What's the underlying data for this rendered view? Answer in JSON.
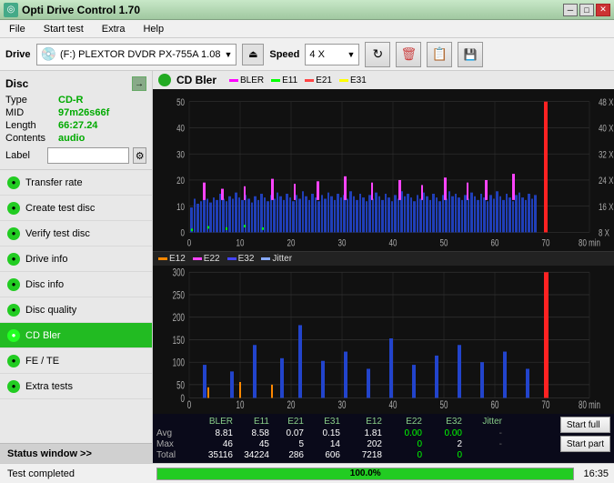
{
  "titleBar": {
    "icon": "◎",
    "title": "Opti Drive Control 1.70",
    "minimize": "─",
    "maximize": "□",
    "close": "✕"
  },
  "menuBar": {
    "items": [
      "File",
      "Start test",
      "Extra",
      "Help"
    ]
  },
  "toolbar": {
    "driveLabel": "Drive",
    "driveText": "(F:) PLEXTOR DVDR  PX-755A 1.08",
    "speedLabel": "Speed",
    "speedValue": "4 X"
  },
  "disc": {
    "title": "Disc",
    "type": {
      "key": "Type",
      "val": "CD-R"
    },
    "mid": {
      "key": "MID",
      "val": "97m26s66f"
    },
    "length": {
      "key": "Length",
      "val": "66:27.24"
    },
    "contents": {
      "key": "Contents",
      "val": "audio"
    },
    "label": {
      "key": "Label",
      "val": ""
    }
  },
  "sidebarNav": [
    {
      "id": "transfer-rate",
      "label": "Transfer rate",
      "active": false
    },
    {
      "id": "create-test-disc",
      "label": "Create test disc",
      "active": false
    },
    {
      "id": "verify-test-disc",
      "label": "Verify test disc",
      "active": false
    },
    {
      "id": "drive-info",
      "label": "Drive info",
      "active": false
    },
    {
      "id": "disc-info",
      "label": "Disc info",
      "active": false
    },
    {
      "id": "disc-quality",
      "label": "Disc quality",
      "active": false
    },
    {
      "id": "cd-bler",
      "label": "CD Bler",
      "active": true
    },
    {
      "id": "fe-te",
      "label": "FE / TE",
      "active": false
    },
    {
      "id": "extra-tests",
      "label": "Extra tests",
      "active": false
    }
  ],
  "statusWindowLabel": "Status window >>",
  "chart": {
    "title": "CD Bler",
    "upperLegend": [
      {
        "color": "#ff00ff",
        "label": "BLER"
      },
      {
        "color": "#00ff00",
        "label": "E11"
      },
      {
        "color": "#ff4444",
        "label": "E21"
      },
      {
        "color": "#ffff00",
        "label": "E31"
      }
    ],
    "lowerLegend": [
      {
        "color": "#ff8800",
        "label": "E12"
      },
      {
        "color": "#ff44ff",
        "label": "E22"
      },
      {
        "color": "#4444ff",
        "label": "E32"
      },
      {
        "color": "#88aaff",
        "label": "Jitter"
      }
    ],
    "upperYAxis": [
      "50",
      "40",
      "30",
      "20",
      "10",
      "0"
    ],
    "upperYAxisRight": [
      "48 X",
      "40 X",
      "32 X",
      "24 X",
      "16 X",
      "8 X"
    ],
    "lowerYAxis": [
      "300",
      "250",
      "200",
      "150",
      "100",
      "50",
      "0"
    ],
    "xAxisLabels": [
      "0",
      "10",
      "20",
      "30",
      "40",
      "50",
      "60",
      "70",
      "80 min"
    ]
  },
  "stats": {
    "columns": [
      "",
      "BLER",
      "E11",
      "E21",
      "E31",
      "E12",
      "E22",
      "E32",
      "Jitter"
    ],
    "rows": [
      {
        "label": "Avg",
        "vals": [
          "8.81",
          "8.58",
          "0.07",
          "0.15",
          "1.81",
          "0.00",
          "0.00",
          "-"
        ]
      },
      {
        "label": "Max",
        "vals": [
          "46",
          "45",
          "5",
          "14",
          "202",
          "0",
          "2",
          "-"
        ]
      },
      {
        "label": "Total",
        "vals": [
          "35116",
          "34224",
          "286",
          "606",
          "7218",
          "0",
          "0",
          ""
        ]
      }
    ]
  },
  "actionBtns": {
    "startFull": "Start full",
    "startPart": "Start part"
  },
  "statusBar": {
    "text": "Test completed",
    "progress": 100.0,
    "progressText": "100.0%",
    "time": "16:35"
  }
}
